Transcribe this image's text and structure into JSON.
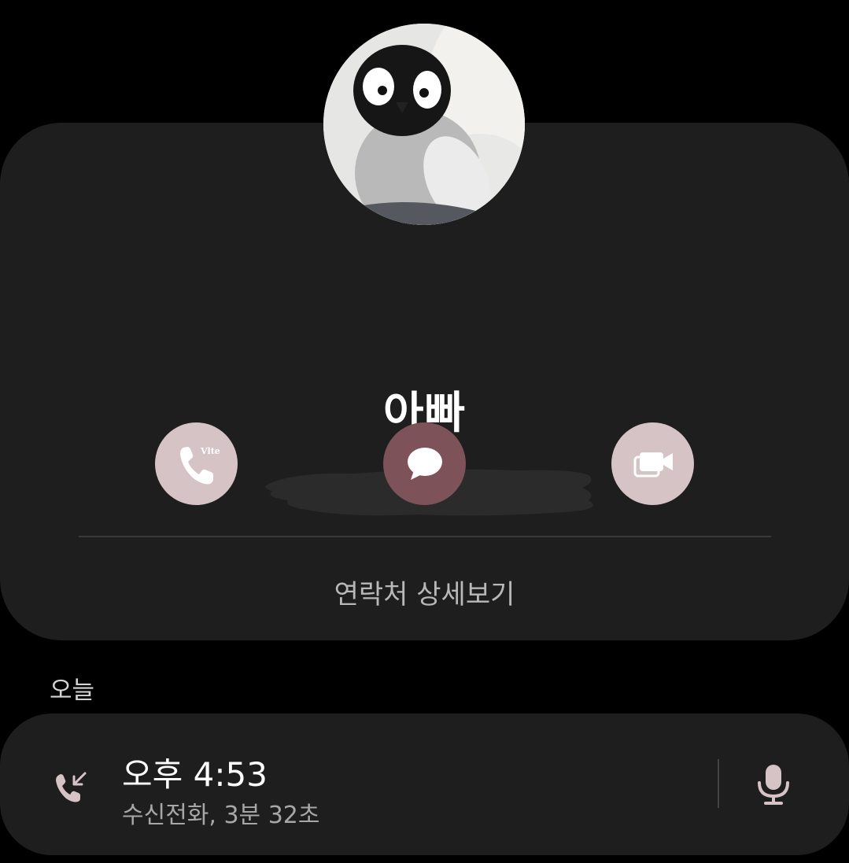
{
  "contact": {
    "name": "아빠",
    "phone_number_redacted": true
  },
  "actions": {
    "call": {
      "icon": "phone-volte-icon",
      "badge_text": "Vlte"
    },
    "message": {
      "icon": "chat-bubble-icon"
    },
    "video": {
      "icon": "video-call-icon"
    }
  },
  "details_link": "연락처 상세보기",
  "history": {
    "section_label": "오늘",
    "entries": [
      {
        "time": "오후 4:53",
        "detail": "수신전화, 3분 32초",
        "type_icon": "incoming-call-icon",
        "action_icon": "voice-recording-icon"
      }
    ]
  },
  "colors": {
    "background": "#000000",
    "card": "#1e1e1e",
    "action_light": "#d6c3c6",
    "action_accent": "#7e5259",
    "secondary_text": "#a7a7a7"
  }
}
